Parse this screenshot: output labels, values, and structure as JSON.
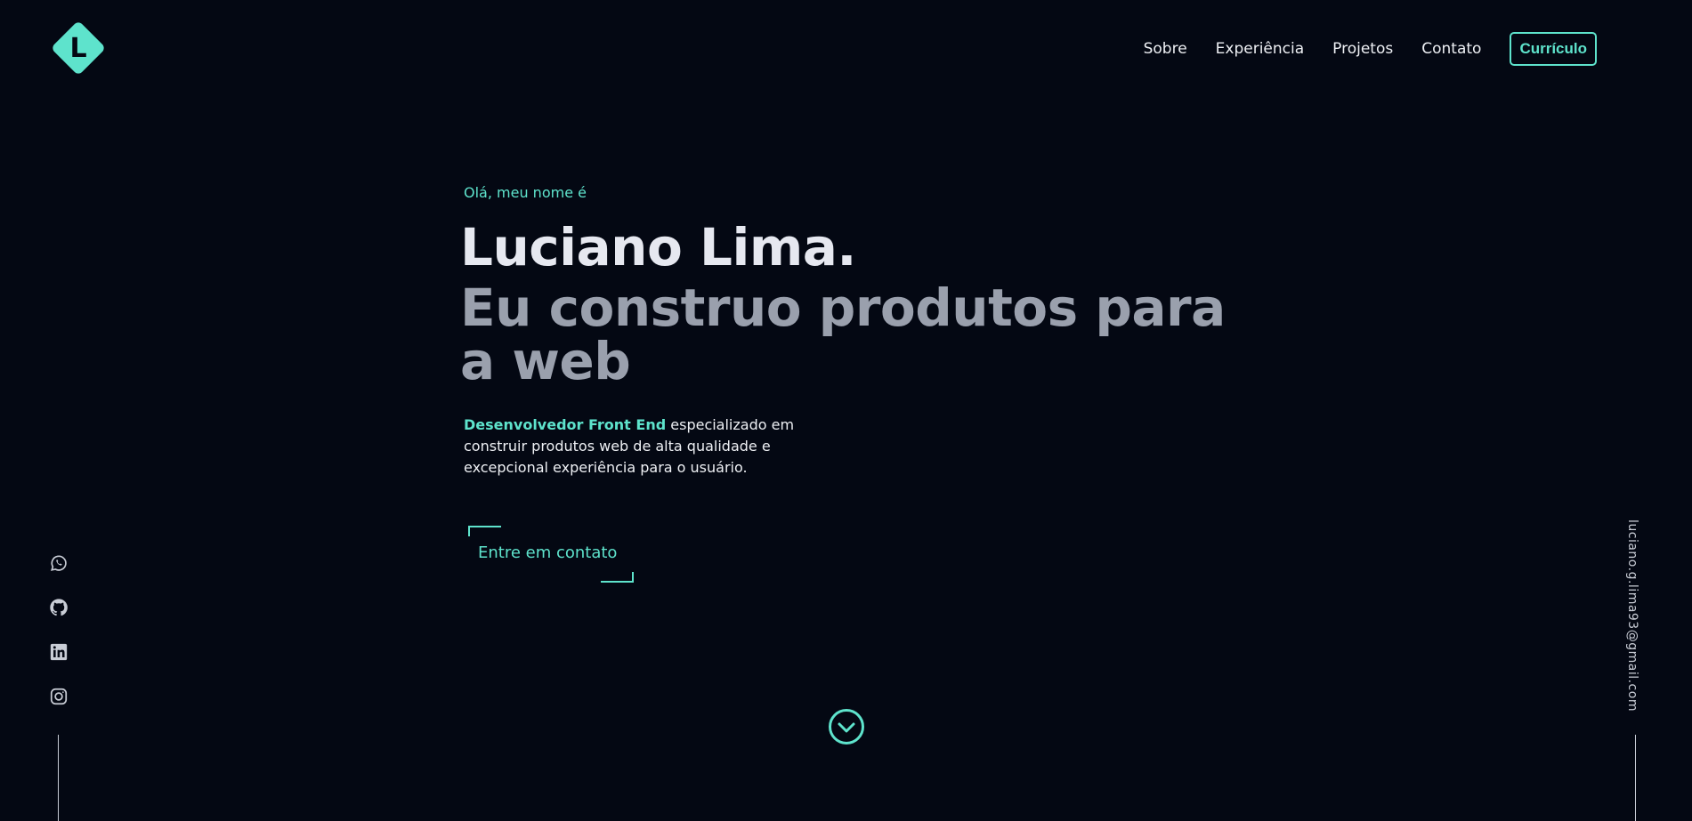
{
  "logo": {
    "letter": "L",
    "icon": "diamond-logo-icon"
  },
  "nav": {
    "items": [
      {
        "label": "Sobre"
      },
      {
        "label": "Experiência"
      },
      {
        "label": "Projetos"
      },
      {
        "label": "Contato"
      }
    ],
    "resume_label": "Currículo"
  },
  "hero": {
    "greeting": "Olá, meu nome é",
    "name": "Luciano Lima.",
    "tagline": "Eu construo produtos para a web",
    "description_highlight": "Desenvolvedor Front End",
    "description_rest": " especializado em construir produtos web de alta qualidade e excepcional experiência para o usuário.",
    "cta_label": "Entre em contato"
  },
  "socials": [
    {
      "icon": "whatsapp-icon"
    },
    {
      "icon": "github-icon"
    },
    {
      "icon": "linkedin-icon"
    },
    {
      "icon": "instagram-icon"
    }
  ],
  "email": "luciano.g.lima93@gmail.com",
  "scroll_icon": "chevron-down-circle-icon",
  "colors": {
    "background": "#040813",
    "accent": "#5ee3cc",
    "heading": "#e6e8f0",
    "subheading": "#9aa0ad",
    "text": "#eef0f4"
  }
}
